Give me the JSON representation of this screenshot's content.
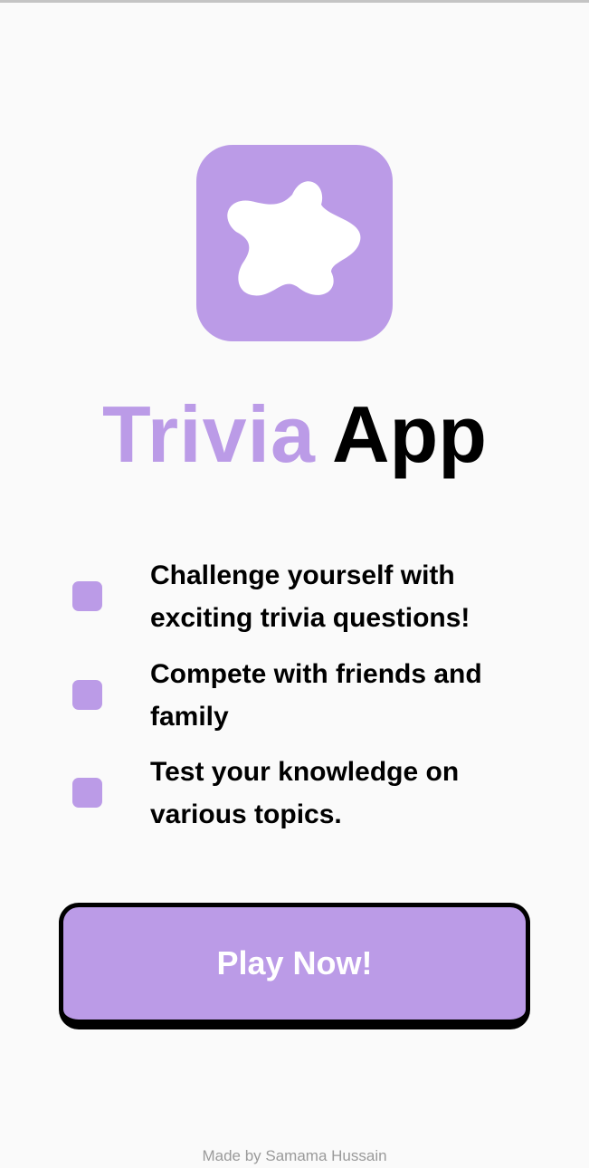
{
  "app": {
    "logo_icon": "star-blob-icon",
    "title_part1": "Trivia",
    "title_part2": "App"
  },
  "features": [
    {
      "icon": "bullet-square-icon",
      "text": "Challenge yourself with exciting trivia questions!"
    },
    {
      "icon": "bullet-square-icon",
      "text": "Compete with friends and family"
    },
    {
      "icon": "bullet-square-icon",
      "text": "Test your knowledge on various topics."
    }
  ],
  "actions": {
    "play_label": "Play Now!"
  },
  "footer": {
    "credit": "Made by Samama Hussain"
  },
  "colors": {
    "accent": "#bb9be7",
    "background": "#fafafa",
    "text": "#000000",
    "muted": "#9a9a9a"
  }
}
